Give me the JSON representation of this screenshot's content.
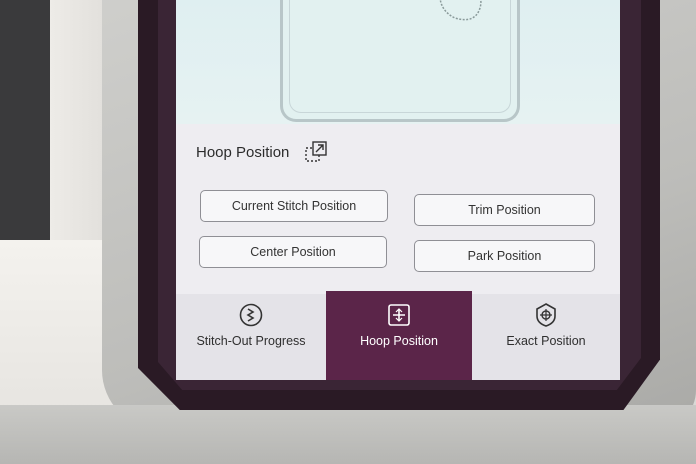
{
  "panel": {
    "title": "Hoop Position",
    "expand_icon": "expand-arrow-icon"
  },
  "buttons": {
    "current_stitch": "Current Stitch Position",
    "trim": "Trim Position",
    "center": "Center Position",
    "park": "Park Position"
  },
  "tabs": [
    {
      "label": "Stitch-Out Progress",
      "icon": "progress-icon",
      "selected": false
    },
    {
      "label": "Hoop Position",
      "icon": "hoop-position-icon",
      "selected": true
    },
    {
      "label": "Exact Position",
      "icon": "exact-position-icon",
      "selected": false
    }
  ],
  "colors": {
    "selected_tab": "#5b2549",
    "frame": "#2a1a25",
    "canvas": "#e2f1f0"
  }
}
